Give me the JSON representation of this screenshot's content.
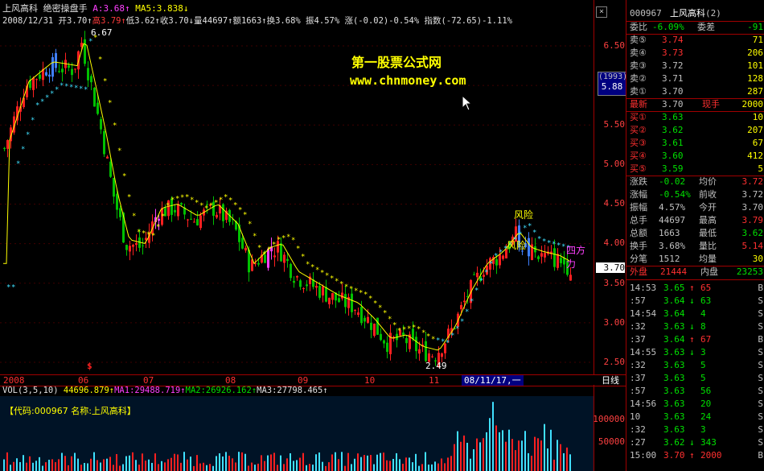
{
  "header": {
    "stock_name": "上风高科",
    "indicator_name": "绝密操盘手",
    "a_label": "A:3.68",
    "ma5_label": "MA5:3.838",
    "line2": {
      "date": "2008/12/31",
      "open": "开3.70",
      "high": "高3.79",
      "low": "低3.62",
      "close": "收3.70",
      "volume": "量44697",
      "amount": "额1663",
      "turnover": "换3.68%",
      "amplitude": "振4.57%",
      "change": "涨(-0.02)-0.54%",
      "index": "指数(-72.65)-1.11%"
    }
  },
  "watermark": {
    "line1": "第一股票公式网",
    "line2": "www.chnmoney.com"
  },
  "annotations": {
    "high_price": "6.67",
    "low_price": "2.49",
    "risk1": "风险",
    "risk2": "风险",
    "sifangli": "四方力",
    "dollar": "$"
  },
  "price_axis": {
    "ticks": [
      "6.50",
      "6.00",
      "5.50",
      "5.00",
      "4.50",
      "4.00",
      "3.50",
      "3.00",
      "2.50"
    ],
    "code_box": "(1993)",
    "price_box": "5.88",
    "current": "3.70"
  },
  "date_axis": {
    "labels": [
      "2008",
      "06",
      "07",
      "08",
      "09",
      "10",
      "11"
    ],
    "cursor_date": "08/11/17,一",
    "period": "日线"
  },
  "volume": {
    "label": "VOL(3,5,10)",
    "vol": "44696.879",
    "ma1": "MA1:29488.719",
    "ma2": "MA2:26926.162",
    "ma3": "MA3:27798.465",
    "info": "【代码:000967 名称:上风高科】",
    "ticks": [
      "100000",
      "50000"
    ]
  },
  "quote": {
    "code": "000967",
    "name": "上风高科",
    "count": "(2)",
    "weibi_label": "委比",
    "weibi_value": "-6.09%",
    "weicha_label": "委差",
    "weicha_value": "-91",
    "sells": [
      {
        "label": "卖⑤",
        "price": "3.74",
        "vol": "71"
      },
      {
        "label": "卖④",
        "price": "3.73",
        "vol": "206"
      },
      {
        "label": "卖③",
        "price": "3.72",
        "vol": "101"
      },
      {
        "label": "卖②",
        "price": "3.71",
        "vol": "128"
      },
      {
        "label": "卖①",
        "price": "3.70",
        "vol": "287"
      }
    ],
    "latest_label": "最新",
    "latest_price": "3.70",
    "xianshou_label": "现手",
    "xianshou_value": "2000",
    "buys": [
      {
        "label": "买①",
        "price": "3.63",
        "vol": "10"
      },
      {
        "label": "买②",
        "price": "3.62",
        "vol": "207"
      },
      {
        "label": "买③",
        "price": "3.61",
        "vol": "67"
      },
      {
        "label": "买④",
        "price": "3.60",
        "vol": "412"
      },
      {
        "label": "买⑤",
        "price": "3.59",
        "vol": "5"
      }
    ],
    "stats": [
      {
        "l1": "涨跌",
        "v1": "-0.02",
        "l2": "均价",
        "v2": "3.72"
      },
      {
        "l1": "涨幅",
        "v1": "-0.54%",
        "l2": "前收",
        "v2": "3.72"
      },
      {
        "l1": "振幅",
        "v1": "4.57%",
        "l2": "今开",
        "v2": "3.70"
      },
      {
        "l1": "总手",
        "v1": "44697",
        "l2": "最高",
        "v2": "3.79"
      },
      {
        "l1": "总额",
        "v1": "1663",
        "l2": "最低",
        "v2": "3.62"
      },
      {
        "l1": "换手",
        "v1": "3.68%",
        "l2": "量比",
        "v2": "5.14"
      },
      {
        "l1": "分笔",
        "v1": "1512",
        "l2": "均量",
        "v2": "30"
      }
    ],
    "waipan_label": "外盘",
    "waipan_value": "21444",
    "neipan_label": "内盘",
    "neipan_value": "23253",
    "ticks": [
      {
        "time": "14:53",
        "price": "3.65",
        "arrow": "↑",
        "vol": "65",
        "side": "B"
      },
      {
        "time": ":57",
        "price": "3.64",
        "arrow": "↓",
        "vol": "63",
        "side": "S"
      },
      {
        "time": "14:54",
        "price": "3.64",
        "arrow": "",
        "vol": "4",
        "side": "S"
      },
      {
        "time": ":32",
        "price": "3.63",
        "arrow": "↓",
        "vol": "8",
        "side": "S"
      },
      {
        "time": ":37",
        "price": "3.64",
        "arrow": "↑",
        "vol": "67",
        "side": "B"
      },
      {
        "time": "14:55",
        "price": "3.63",
        "arrow": "↓",
        "vol": "3",
        "side": "S"
      },
      {
        "time": ":32",
        "price": "3.63",
        "arrow": "",
        "vol": "5",
        "side": "S"
      },
      {
        "time": ":37",
        "price": "3.63",
        "arrow": "",
        "vol": "5",
        "side": "S"
      },
      {
        "time": ":57",
        "price": "3.63",
        "arrow": "",
        "vol": "56",
        "side": "S"
      },
      {
        "time": "14:56",
        "price": "3.63",
        "arrow": "",
        "vol": "20",
        "side": "S"
      },
      {
        "time": "10",
        "price": "3.63",
        "arrow": "",
        "vol": "24",
        "side": "S"
      },
      {
        "time": ":32",
        "price": "3.63",
        "arrow": "",
        "vol": "3",
        "side": "S"
      },
      {
        "time": ":27",
        "price": "3.62",
        "arrow": "↓",
        "vol": "343",
        "side": "S"
      },
      {
        "time": "15:00",
        "price": "3.70",
        "arrow": "↑",
        "vol": "2000",
        "side": "B"
      }
    ]
  },
  "colors": {
    "up": "#ff2020",
    "down": "#00c000",
    "grid": "#a00000",
    "ma": "#ffff00",
    "trend": "#40e0ff",
    "accent": "#ff40ff"
  }
}
